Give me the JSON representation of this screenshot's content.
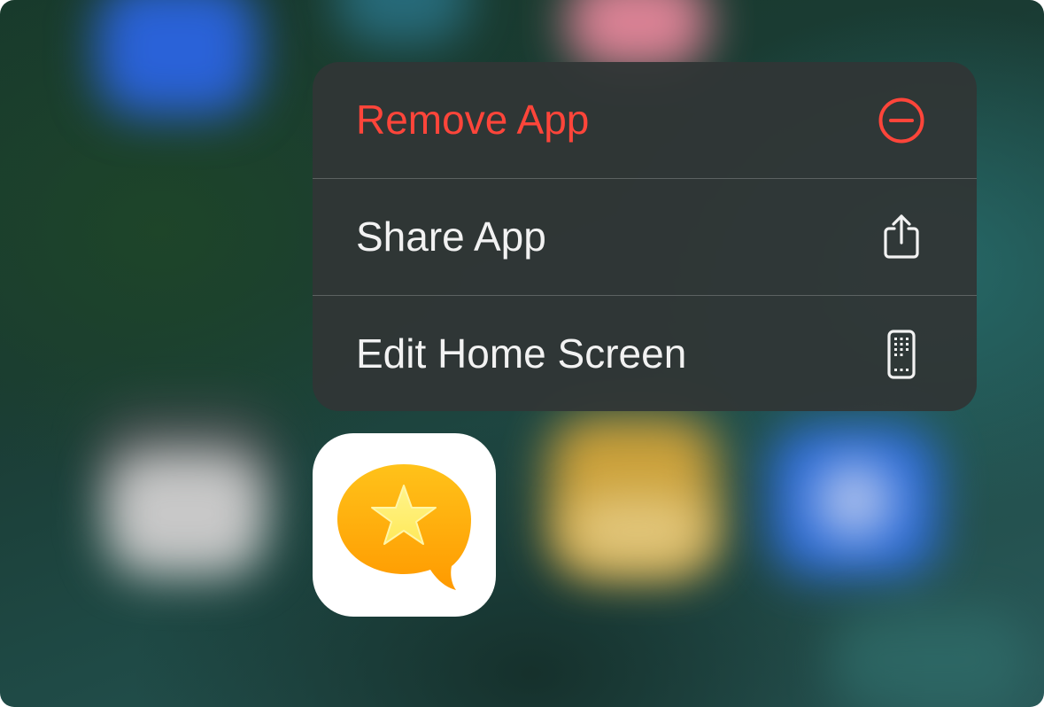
{
  "context_menu": {
    "items": [
      {
        "label": "Remove App",
        "icon": "minus-circle-icon",
        "destructive": true
      },
      {
        "label": "Share App",
        "icon": "share-icon",
        "destructive": false
      },
      {
        "label": "Edit Home Screen",
        "icon": "phone-apps-icon",
        "destructive": false
      }
    ]
  },
  "app": {
    "icon": "star-speech-bubble-icon"
  },
  "colors": {
    "destructive": "#ff453a",
    "menu_text": "#f2f2f2",
    "menu_background": "#303636",
    "app_bubble": "#ffb000",
    "app_star": "#fff36b"
  }
}
